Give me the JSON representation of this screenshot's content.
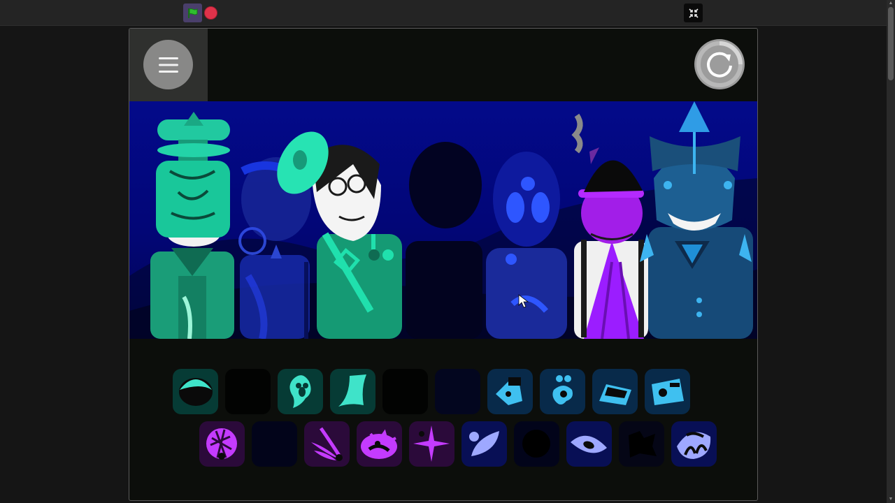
{
  "toolbar": {
    "green_flag_icon": "green-flag-icon",
    "stop_icon": "stop-icon",
    "shrink_icon": "shrink-stage-icon"
  },
  "game": {
    "menu_icon": "hamburger-menu-icon",
    "reset_icon": "reset-icon",
    "colors": {
      "background": "#0c0e0b",
      "scene": "#030a8a",
      "teal": "#1ee0b0",
      "blue": "#1a3cff",
      "purple": "#9b1dff",
      "steel": "#1a5c8c"
    },
    "characters": [
      {
        "name": "teal-helmet",
        "state": "active"
      },
      {
        "name": "blue-monocle",
        "state": "dim"
      },
      {
        "name": "teal-cap-glasses",
        "state": "active"
      },
      {
        "name": "shadow",
        "state": "empty"
      },
      {
        "name": "blue-three-eyes",
        "state": "dim"
      },
      {
        "name": "purple-hat-smoke",
        "state": "active"
      },
      {
        "name": "steel-crown",
        "state": "active"
      }
    ],
    "sound_row_top": [
      {
        "icon": "teal-orb-icon",
        "state": "active"
      },
      {
        "icon": "empty-slot",
        "state": "empty"
      },
      {
        "icon": "teal-ghost-icon",
        "state": "active"
      },
      {
        "icon": "teal-tail-icon",
        "state": "active"
      },
      {
        "icon": "empty-slot",
        "state": "empty"
      },
      {
        "icon": "empty-slot",
        "state": "empty"
      },
      {
        "icon": "blue-tag-icon",
        "state": "active"
      },
      {
        "icon": "blue-drops-icon",
        "state": "active"
      },
      {
        "icon": "blue-wedge-icon",
        "state": "active"
      },
      {
        "icon": "blue-box-icon",
        "state": "active"
      }
    ],
    "sound_row_bottom": [
      {
        "icon": "purple-net-icon",
        "state": "active"
      },
      {
        "icon": "empty-slot",
        "state": "empty"
      },
      {
        "icon": "purple-claw-icon",
        "state": "active"
      },
      {
        "icon": "purple-burst-icon",
        "state": "active"
      },
      {
        "icon": "purple-spark-icon",
        "state": "active"
      },
      {
        "icon": "indigo-leaf-icon",
        "state": "active"
      },
      {
        "icon": "empty-slot",
        "state": "empty"
      },
      {
        "icon": "indigo-eye-icon",
        "state": "active"
      },
      {
        "icon": "empty-slot",
        "state": "empty"
      },
      {
        "icon": "indigo-face-icon",
        "state": "active"
      }
    ]
  }
}
